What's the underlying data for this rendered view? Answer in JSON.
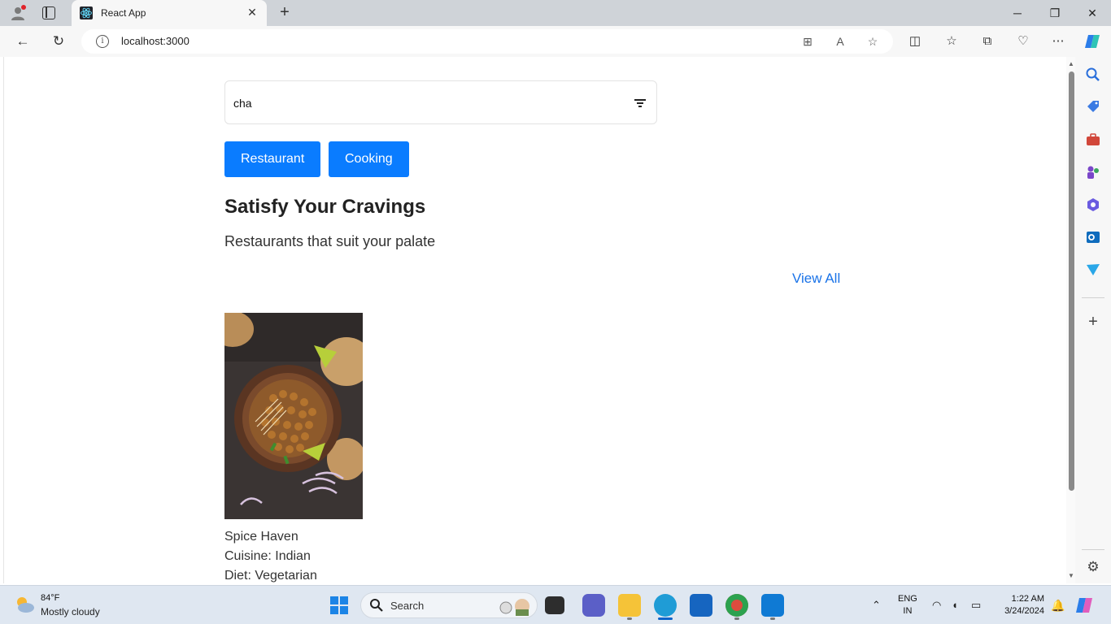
{
  "browser": {
    "tab_title": "React App",
    "url": "localhost:3000",
    "new_tab_glyph": "+",
    "tab_close_glyph": "✕",
    "window_controls": {
      "minimize": "─",
      "restore": "❐",
      "close": "✕"
    }
  },
  "app": {
    "search": {
      "value": "cha"
    },
    "buttons": {
      "restaurant": "Restaurant",
      "cooking": "Cooking"
    },
    "heading": "Satisfy Your Cravings",
    "subheading": "Restaurants that suit your palate",
    "view_all": "View All",
    "cards": [
      {
        "name": "Spice Haven",
        "cuisine": "Cuisine: Indian",
        "diet": "Diet: Vegetarian"
      }
    ]
  },
  "taskbar": {
    "weather": {
      "temp": "84°F",
      "desc": "Mostly cloudy"
    },
    "search_label": "Search",
    "language": {
      "line1": "ENG",
      "line2": "IN"
    },
    "clock": {
      "time": "1:22 AM",
      "date": "3/24/2024"
    }
  },
  "colors": {
    "primary_button": "#0a7cff",
    "link": "#1a73e8",
    "titlebar": "#cfd3d8",
    "taskbar": "#dfe7f1"
  }
}
